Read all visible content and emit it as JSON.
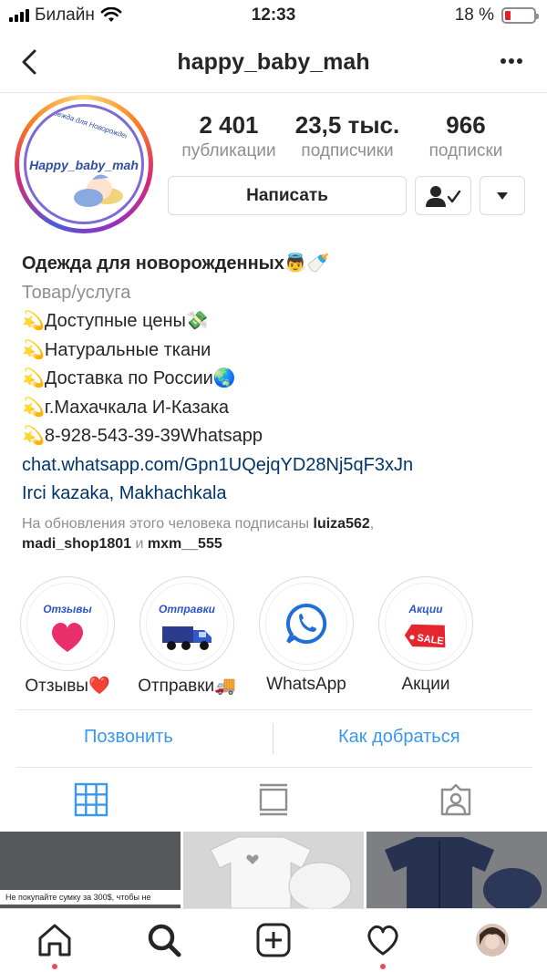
{
  "status_bar": {
    "carrier": "Билайн",
    "time": "12:33",
    "battery_percent": "18 %",
    "battery_level": 0.18
  },
  "nav": {
    "username": "happy_baby_mah",
    "back_icon": "chevron-left-icon",
    "more_icon": "more-horizontal-icon"
  },
  "avatar": {
    "logo_text": "Happy_baby_mah",
    "arc_text": "Одежда для Новорожденных"
  },
  "stats": [
    {
      "value": "2 401",
      "label": "публикации"
    },
    {
      "value": "23,5 тыс.",
      "label": "подписчики"
    },
    {
      "value": "966",
      "label": "подписки"
    }
  ],
  "buttons": {
    "message": "Написать",
    "following_icon": "person-check-icon",
    "dropdown_icon": "caret-down-icon"
  },
  "bio": {
    "name": "Одежда для новорожденных👼🍼",
    "category": "Товар/услуга",
    "lines": [
      "💫Доступные цены💸",
      "💫Натуральные ткани",
      "💫Доставка по России🌏",
      "💫г.Махачкала И-Казака",
      "💫8-928-543-39-39Whatsapp"
    ],
    "link": "chat.whatsapp.com/Gpn1UQejqYD28Nj5qF3xJn",
    "location": "Irci kazaka, Makhachkala",
    "followed_prefix": "На обновления этого человека подписаны ",
    "followed_user1": "luiza562",
    "followed_sep1": ",",
    "followed_user2": "madi_shop1801",
    "followed_and": " и ",
    "followed_user3": "mxm__555"
  },
  "highlights": [
    {
      "cover_title": "Отзывы",
      "label": "Отзывы❤️",
      "icon": "heart-icon"
    },
    {
      "cover_title": "Отправки",
      "label": "Отправки🚚",
      "icon": "truck-icon"
    },
    {
      "cover_title": "",
      "label": "WhatsApp",
      "icon": "whatsapp-icon"
    },
    {
      "cover_title": "Акции",
      "label": "Акции",
      "icon": "sale-tag-icon",
      "tag_text": "SALE"
    }
  ],
  "contact": {
    "call": "Позвонить",
    "directions": "Как добраться"
  },
  "tabs": [
    {
      "name": "grid",
      "icon": "grid-icon",
      "active": true
    },
    {
      "name": "feed",
      "icon": "feed-icon",
      "active": false
    },
    {
      "name": "tagged",
      "icon": "tagged-person-icon",
      "active": false
    }
  ],
  "posts": [
    {
      "caption": "Не покупайте сумку за 300$, чтобы не"
    },
    {
      "caption": ""
    },
    {
      "caption": ""
    }
  ],
  "bottom_nav": [
    {
      "name": "home",
      "icon": "home-icon"
    },
    {
      "name": "search",
      "icon": "search-icon"
    },
    {
      "name": "new-post",
      "icon": "plus-square-icon"
    },
    {
      "name": "activity",
      "icon": "heart-outline-icon"
    },
    {
      "name": "profile",
      "icon": "profile-avatar-icon"
    }
  ],
  "colors": {
    "accent_blue": "#3897f0",
    "link_blue": "#003569",
    "notification_red": "#ed4956",
    "text_primary": "#262626",
    "text_secondary": "#8e8e8e"
  }
}
